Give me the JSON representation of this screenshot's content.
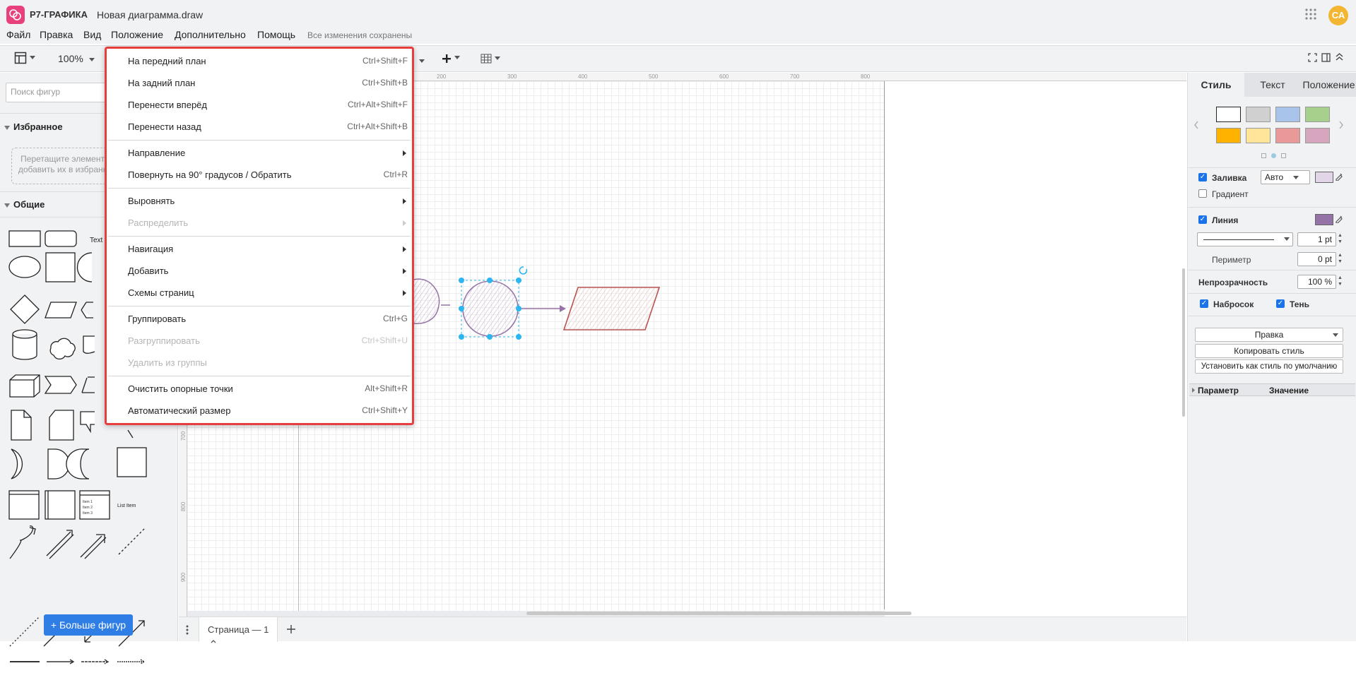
{
  "app": {
    "name": "Р7-ГРАФИКА",
    "document_title": "Новая диаграмма.draw",
    "avatar_initials": "СА"
  },
  "menubar": {
    "items": [
      "Файл",
      "Правка",
      "Вид",
      "Положение",
      "Дополнительно",
      "Помощь"
    ],
    "status": "Все изменения сохранены"
  },
  "toolbar": {
    "zoom": "100%"
  },
  "sidebar": {
    "search_placeholder": "Поиск фигур",
    "favorites_title": "Избранное",
    "favorites_hint": "Перетащите элементы сюда, чтобы добавить их в избранное диаграммы",
    "general_title": "Общие",
    "text_shape_label": "Text",
    "list_item_label": "List Item",
    "more_shapes": "Больше фигур"
  },
  "ruler": {
    "top_labels": [
      "200",
      "300",
      "400",
      "500",
      "600",
      "700",
      "800"
    ],
    "left_labels": [
      "700",
      "800",
      "900"
    ]
  },
  "pagebar": {
    "tab_label": "Страница — 1"
  },
  "right_panel": {
    "tabs": [
      "Стиль",
      "Текст",
      "Положение"
    ],
    "fill_label": "Заливка",
    "fill_mode": "Авто",
    "gradient_label": "Градиент",
    "line_label": "Линия",
    "line_width": "1 pt",
    "perimeter_label": "Периметр",
    "perimeter_value": "0 pt",
    "opacity_label": "Непрозрачность",
    "opacity_value": "100 %",
    "sketch_label": "Набросок",
    "shadow_label": "Тень",
    "edit_select": "Правка",
    "copy_style": "Копировать стиль",
    "set_default_style": "Установить как стиль по умолчанию",
    "param_header": "Параметр",
    "value_header": "Значение",
    "swatch_colors": [
      "#ffffff",
      "#d0d0d0",
      "#a9c4eb",
      "#a8d08d",
      "#ffb300",
      "#ffe599",
      "#ea9999",
      "#d5a6bd"
    ],
    "fill_color": "#e1d5e7",
    "line_color": "#9673a6"
  },
  "context_menu": {
    "items": [
      {
        "label": "На передний план",
        "shortcut": "Ctrl+Shift+F"
      },
      {
        "label": "На задний план",
        "shortcut": "Ctrl+Shift+B"
      },
      {
        "label": "Перенести вперёд",
        "shortcut": "Ctrl+Alt+Shift+F"
      },
      {
        "label": "Перенести назад",
        "shortcut": "Ctrl+Alt+Shift+B"
      },
      {
        "label": "Направление",
        "submenu": true
      },
      {
        "label": "Повернуть на 90° градусов / Обратить",
        "shortcut": "Ctrl+R"
      },
      {
        "label": "Выровнять",
        "submenu": true
      },
      {
        "label": "Распределить",
        "submenu": true,
        "disabled": true
      },
      {
        "label": "Навигация",
        "submenu": true
      },
      {
        "label": "Добавить",
        "submenu": true
      },
      {
        "label": "Схемы страниц",
        "submenu": true
      },
      {
        "label": "Группировать",
        "shortcut": "Ctrl+G"
      },
      {
        "label": "Разгруппировать",
        "shortcut": "Ctrl+Shift+U",
        "disabled": true
      },
      {
        "label": "Удалить из группы",
        "disabled": true
      },
      {
        "label": "Очистить опорные точки",
        "shortcut": "Alt+Shift+R"
      },
      {
        "label": "Автоматический размер",
        "shortcut": "Ctrl+Shift+Y"
      }
    ]
  }
}
